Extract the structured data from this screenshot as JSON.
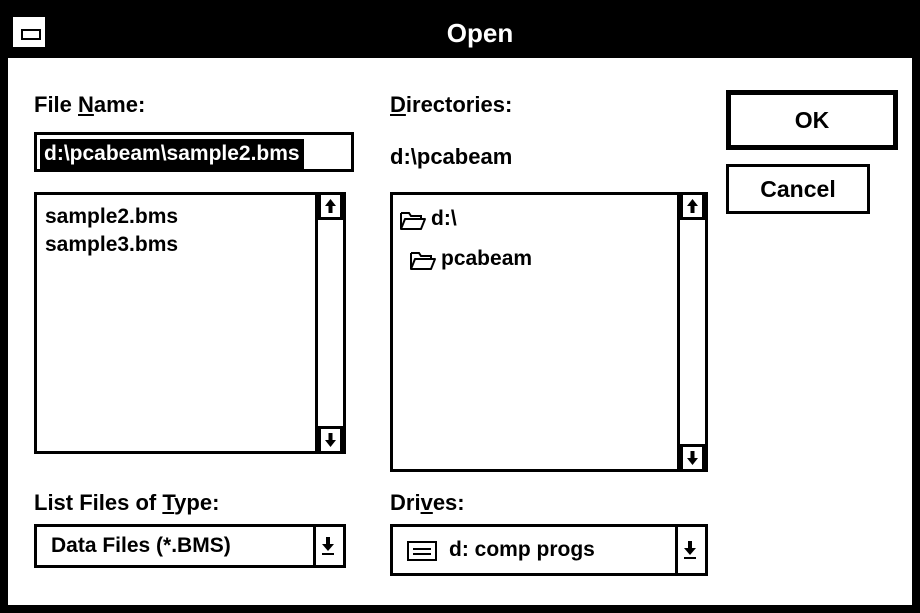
{
  "window": {
    "title": "Open"
  },
  "file_name": {
    "label_prefix": "File ",
    "label_accel": "N",
    "label_suffix": "ame:",
    "value": "d:\\pcabeam\\sample2.bms",
    "files": [
      "sample2.bms",
      "sample3.bms"
    ]
  },
  "directories": {
    "label_accel": "D",
    "label_suffix": "irectories:",
    "current_path": "d:\\pcabeam",
    "items": [
      {
        "name": "d:\\",
        "icon": "open-folder-icon"
      },
      {
        "name": "pcabeam",
        "icon": "open-folder-icon"
      }
    ]
  },
  "buttons": {
    "ok": "OK",
    "cancel": "Cancel"
  },
  "file_type": {
    "label_prefix": "List Files of ",
    "label_accel": "T",
    "label_suffix": "ype:",
    "selected": "Data Files (*.BMS)"
  },
  "drives": {
    "label_prefix": "Dri",
    "label_accel": "v",
    "label_suffix": "es:",
    "selected": "d: comp progs",
    "icon": "drive-icon"
  },
  "colors": {
    "background": "#ffffff",
    "foreground": "#000000",
    "title_bar": "#000000",
    "selection": "#000000"
  }
}
